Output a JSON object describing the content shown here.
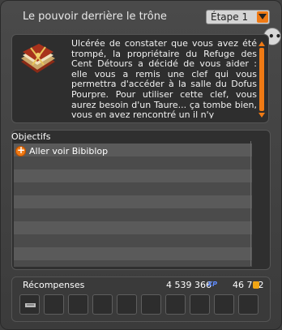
{
  "window": {
    "title": "Le pouvoir derrière le trône",
    "step_select": {
      "value": "Étape 1"
    },
    "more_label": "•••"
  },
  "description": {
    "text": "Ulcérée de constater que vous avez été trompé, la propriétaire du Refuge des Cent Détours a décidé de vous aider : elle vous a remis une clef qui vous permettra d'accéder à la salle du Dofus Pourpre. Pour utiliser cette clef, vous aurez besoin d'un Taure... ça tombe bien, vous en avez rencontré un il n'y"
  },
  "objectives": {
    "header": "Objectifs",
    "items": [
      {
        "label": "Aller voir Bibiblop",
        "icon": "plus-circle-icon"
      }
    ]
  },
  "rewards": {
    "label": "Récompenses",
    "xp": "4 539 366",
    "xp_tag": "XP",
    "kamas": "46 752"
  },
  "colors": {
    "accent": "#f07a14",
    "text": "#ffffff",
    "xp": "#5f8cff"
  }
}
